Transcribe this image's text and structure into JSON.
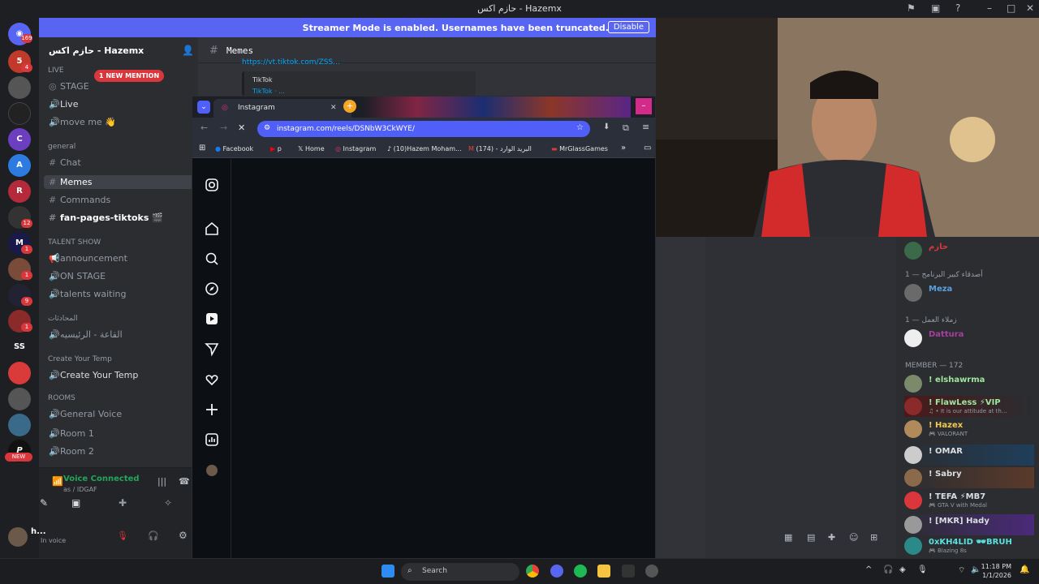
{
  "window": {
    "title": "حازم اكس - Hazemx"
  },
  "banner": {
    "message": "Streamer Mode is enabled. Usernames have been truncated.",
    "disable": "Disable"
  },
  "rail": {
    "badges": [
      "169",
      "4",
      "12",
      "1",
      "1",
      "9",
      "1"
    ],
    "labels": [
      "SS",
      "NEW"
    ]
  },
  "server": {
    "name": "حازم اكس - Hazemx",
    "mention": "1 NEW MENTION",
    "categories": [
      "LIVE",
      "general",
      "TALENT SHOW",
      "المحادثات",
      "Create Your Temp",
      "ROOMS"
    ],
    "channels": {
      "stage": "STAGE",
      "live": "Live",
      "move": "move me 👋",
      "chat": "Chat",
      "memes": "Memes",
      "commands": "Commands",
      "fanpages": "fan-pages-tiktoks 🎬",
      "announcement": "announcement",
      "onstage": "ON STAGE",
      "talents": "talents waiting",
      "hall": "القاعة - الرئيسيه",
      "createtemp": "Create Your Temp",
      "general_voice": "General Voice",
      "room1": "Room 1",
      "room2": "Room 2"
    }
  },
  "voice": {
    "status": "Voice Connected",
    "channel": "as / IDGAF"
  },
  "user": {
    "name": "h...",
    "status": "In voice"
  },
  "chat": {
    "channel": "Memes",
    "link": "https://vt.tiktok.com/ZSS...",
    "embed_title": "TikTok",
    "embed_sub": "TikTok · ..."
  },
  "browser": {
    "tab": "Instagram",
    "url": "instagram.com/reels/DSNbW3CkWYE/",
    "bookmarks": [
      "Facebook",
      "p",
      "Home",
      "Instagram",
      "(10)Hazem Moham...",
      "(174) - البريد الوارد",
      "MrGlassGames"
    ]
  },
  "members": {
    "role1": "أصدقاء كبير البرنامج — 1",
    "role2": "زملاء العمل — 1",
    "role3": "MEMBER — 172",
    "top": [
      {
        "name": "حازم"
      },
      {
        "name": "Meza"
      },
      {
        "name": "Dattura"
      }
    ],
    "list": [
      {
        "name": "! elshawrma",
        "status": ""
      },
      {
        "name": "! FlawLess ⚡VIP",
        "status": "♫ • It is our attitude at th..."
      },
      {
        "name": "! Hazex",
        "status": "🎮 VALORANT"
      },
      {
        "name": "! OMAR",
        "status": ""
      },
      {
        "name": "! Sabry",
        "status": ""
      },
      {
        "name": "! TEFA ⚡MB7",
        "status": "🎮 GTA V with Medal"
      },
      {
        "name": "! [MKR] Hady",
        "status": ""
      },
      {
        "name": "0xKH4LID 🕶BRUH",
        "status": "🎮 Blazing 8s"
      }
    ]
  },
  "taskbar": {
    "search": "Search",
    "time": "11:18 PM",
    "date": "1/1/2026"
  },
  "colors": {
    "accent": "#5865f2",
    "mention": "#da373c",
    "online": "#23a55a",
    "dattura": "#a53fa0"
  }
}
